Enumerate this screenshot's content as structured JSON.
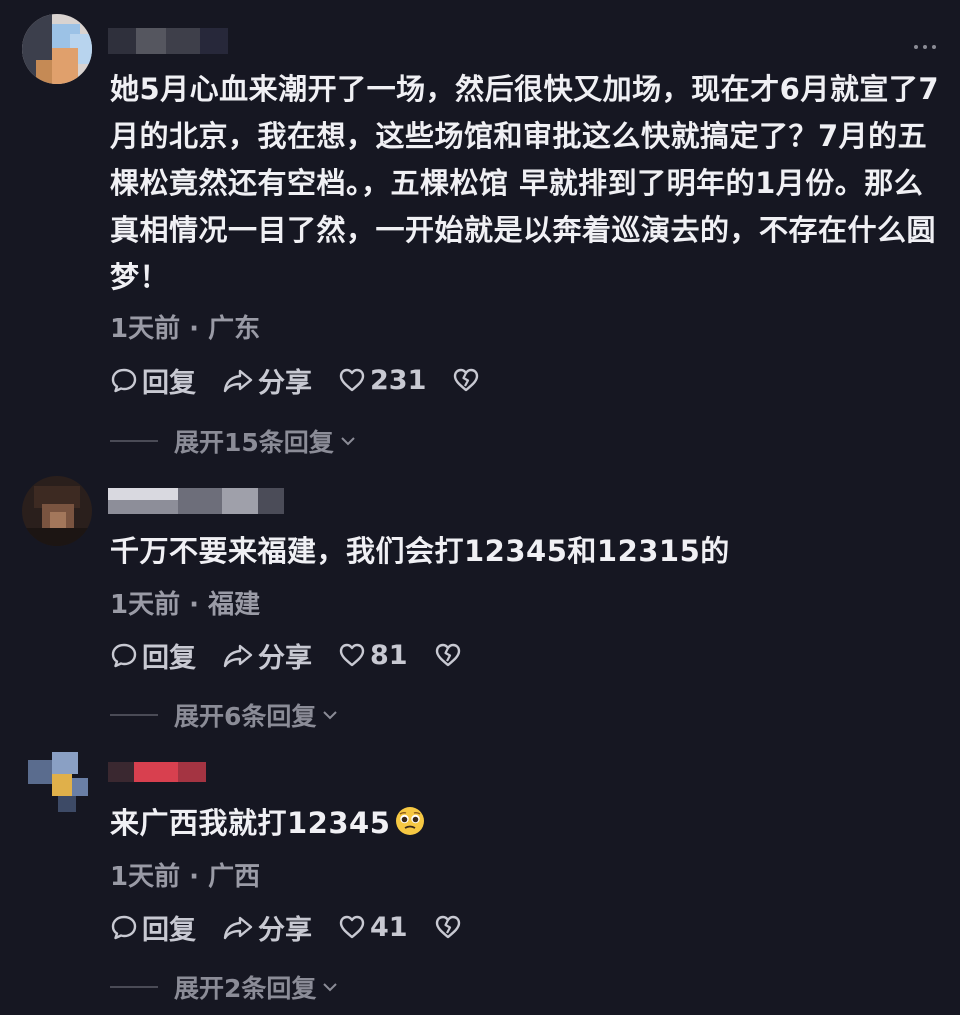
{
  "comments": [
    {
      "text": "她5月心血来潮开了一场，然后很快又加场，现在才6月就宣了7月的北京，我在想，这些场馆和审批这么快就搞定了？7月的五棵松竟然还有空档。，五棵松馆 早就排到了明年的1月份。那么真相情况一目了然，一开始就是以奔着巡演去的，不存在什么圆梦！",
      "meta": "1天前 · 广东",
      "reply_label": "回复",
      "share_label": "分享",
      "likes": "231",
      "expand_label": "展开15条回复"
    },
    {
      "text": "千万不要来福建，我们会打12345和12315的",
      "meta": "1天前 · 福建",
      "reply_label": "回复",
      "share_label": "分享",
      "likes": "81",
      "expand_label": "展开6条回复"
    },
    {
      "text": "来广西我就打12345",
      "meta": "1天前 · 广西",
      "reply_label": "回复",
      "share_label": "分享",
      "likes": "41",
      "expand_label": "展开2条回复"
    }
  ],
  "icons": {
    "more": "more-dots-icon",
    "reply": "speech-bubble-icon",
    "share": "share-arrow-icon",
    "like": "heart-icon",
    "dislike": "broken-heart-icon",
    "expand": "chevron-down-icon",
    "emoji": "pleading-face-emoji"
  },
  "colors": {
    "background": "#161722",
    "text": "#f0f0f4",
    "meta": "#9a9ba6",
    "accent_red": "#e8404f"
  }
}
